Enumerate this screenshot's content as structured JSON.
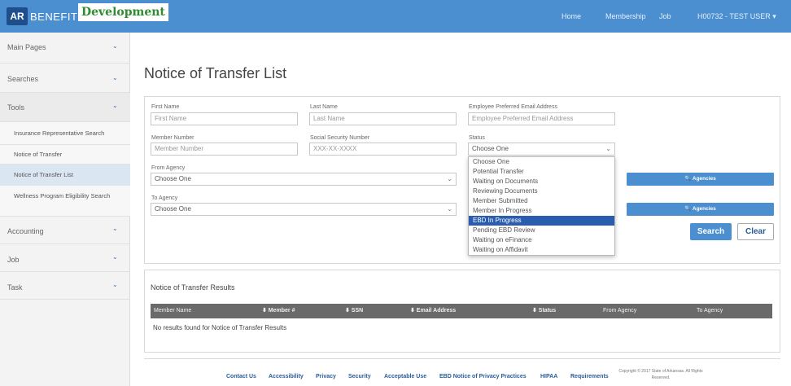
{
  "header": {
    "logo_ar": "AR",
    "logo_benefits": "BENEFITS",
    "env_badge": "Development",
    "nav": [
      "Home",
      "Membership",
      "Job",
      "H00732 - TEST USER ▾"
    ]
  },
  "sidebar": {
    "main_pages": "Main Pages",
    "searches": "Searches",
    "tools": "Tools",
    "tools_items": [
      "Insurance Representative Search",
      "Notice of Transfer",
      "Notice of Transfer List",
      "Wellness Program Eligibility Search"
    ],
    "accounting": "Accounting",
    "job": "Job",
    "task": "Task",
    "chevron": "⌄"
  },
  "page": {
    "title": "Notice of Transfer List"
  },
  "form": {
    "first_name": {
      "label": "First Name",
      "placeholder": "First Name"
    },
    "last_name": {
      "label": "Last Name",
      "placeholder": "Last Name"
    },
    "email": {
      "label": "Employee Preferred Email Address",
      "placeholder": "Employee Preferred Email Address"
    },
    "member_number": {
      "label": "Member Number",
      "placeholder": "Member Number"
    },
    "ssn": {
      "label": "Social Security Number",
      "placeholder": "XXX-XX-XXXX"
    },
    "status": {
      "label": "Status",
      "value": "Choose One",
      "options": [
        "Choose One",
        "Potential Transfer",
        "Waiting on Documents",
        "Reviewing Documents",
        "Member Submitted",
        "Member In Progress",
        "EBD In Progress",
        "Pending EBD Review",
        "Waiting on eFinance",
        "Waiting on Affidavit"
      ],
      "highlighted": "EBD In Progress"
    },
    "from_agency": {
      "label": "From Agency",
      "value": "Choose One"
    },
    "to_agency": {
      "label": "To Agency",
      "value": "Choose One"
    },
    "agencies_button": "🔍 Agencies",
    "search_button": "Search",
    "clear_button": "Clear"
  },
  "results": {
    "title": "Notice of Transfer Results",
    "columns": [
      "Member Name",
      "⬍ Member #",
      "⬍ SSN",
      "⬍ Email Address",
      "⬍ Status",
      "From Agency",
      "To Agency"
    ],
    "empty_text": "No results found for Notice of Transfer Results"
  },
  "footer": {
    "links": [
      "Contact Us",
      "Accessibility",
      "Privacy",
      "Security",
      "Acceptable Use",
      "EBD Notice of Privacy Practices",
      "HIPAA",
      "Requirements"
    ],
    "copyright": "Copyright © 2017 State of Arkansas. All Rights Reserved."
  },
  "colors": {
    "header": "#4b8fd0",
    "highlight": "#2a5db0",
    "table_header": "#6a6a6a"
  }
}
